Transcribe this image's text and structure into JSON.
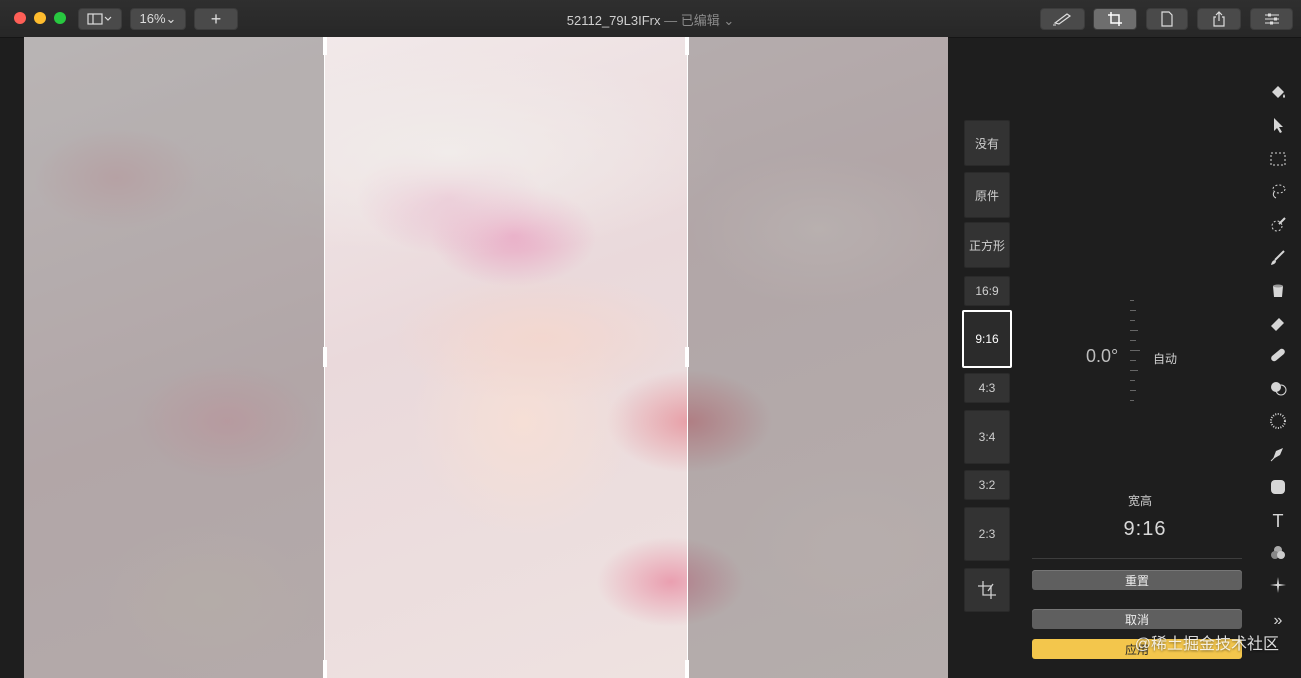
{
  "window": {
    "title": "52112_79L3IFrx",
    "edited": "— 已编辑 ⌄",
    "zoom": "16%⌄"
  },
  "ratios": [
    {
      "label": "没有"
    },
    {
      "label": "原件"
    },
    {
      "label": "正方形"
    },
    {
      "label": "16:9"
    },
    {
      "label": "9:16"
    },
    {
      "label": "4:3"
    },
    {
      "label": "3:4"
    },
    {
      "label": "3:2"
    },
    {
      "label": "2:3"
    }
  ],
  "selected_ratio": "9:16",
  "panel": {
    "angle": "0.0°",
    "auto_label": "自动",
    "aspect_label": "宽高",
    "aspect_value": "9:16",
    "reset_label": "重置",
    "cancel_label": "取消",
    "apply_label": "应用"
  },
  "watermark": "@稀土掘金技术社区",
  "accent_color": "#f3c64c"
}
